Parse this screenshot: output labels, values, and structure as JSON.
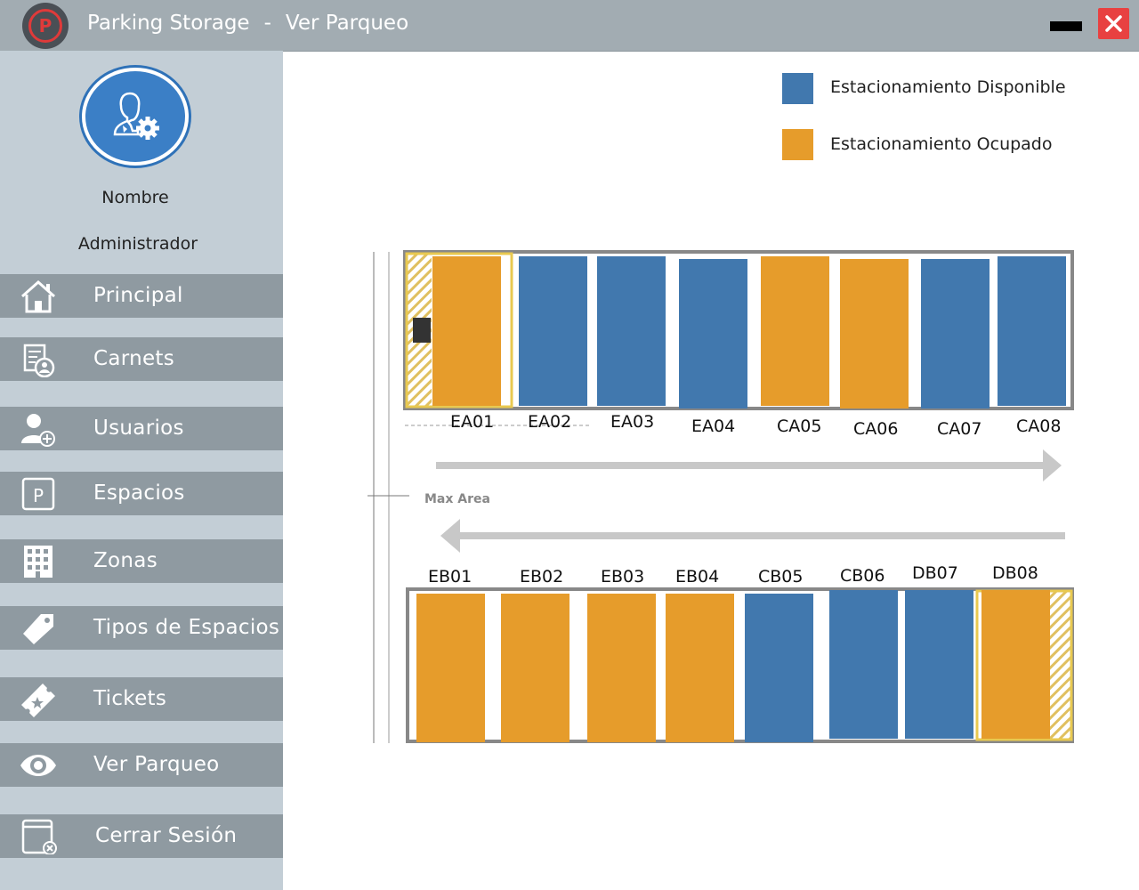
{
  "window": {
    "app_name": "Parking Storage",
    "separator": "-",
    "page_name": "Ver Parqueo",
    "close_color": "#e84141"
  },
  "user": {
    "name": "Nombre",
    "role": "Administrador",
    "avatar_icon": "user-gear-icon"
  },
  "nav": [
    {
      "label": "Principal",
      "icon": "home-icon"
    },
    {
      "label": "Carnets",
      "icon": "id-card-icon"
    },
    {
      "label": "Usuarios",
      "icon": "add-user-icon"
    },
    {
      "label": "Espacios",
      "icon": "parking-sign-icon"
    },
    {
      "label": "Zonas",
      "icon": "building-icon"
    },
    {
      "label": "Tipos de Espacios",
      "icon": "tag-icon"
    },
    {
      "label": "Tickets",
      "icon": "ticket-icon"
    },
    {
      "label": "Ver Parqueo",
      "icon": "eye-icon"
    },
    {
      "label": "Cerrar Sesión",
      "icon": "logout-icon"
    }
  ],
  "legend": {
    "available_label": "Estacionamiento Disponible",
    "occupied_label": "Estacionamiento Ocupado",
    "available_color": "#4178ae",
    "occupied_color": "#e69c2b"
  },
  "lot": {
    "max_area_label": "Max Area",
    "top_row": [
      {
        "id": "EA01",
        "status": "occupied"
      },
      {
        "id": "EA02",
        "status": "available"
      },
      {
        "id": "EA03",
        "status": "available"
      },
      {
        "id": "EA04",
        "status": "available"
      },
      {
        "id": "CA05",
        "status": "occupied"
      },
      {
        "id": "CA06",
        "status": "occupied"
      },
      {
        "id": "CA07",
        "status": "available"
      },
      {
        "id": "CA08",
        "status": "available"
      }
    ],
    "bottom_row": [
      {
        "id": "EB01",
        "status": "occupied"
      },
      {
        "id": "EB02",
        "status": "occupied"
      },
      {
        "id": "EB03",
        "status": "occupied"
      },
      {
        "id": "EB04",
        "status": "occupied"
      },
      {
        "id": "CB05",
        "status": "available"
      },
      {
        "id": "CB06",
        "status": "available"
      },
      {
        "id": "DB07",
        "status": "available"
      },
      {
        "id": "DB08",
        "status": "occupied"
      }
    ]
  }
}
